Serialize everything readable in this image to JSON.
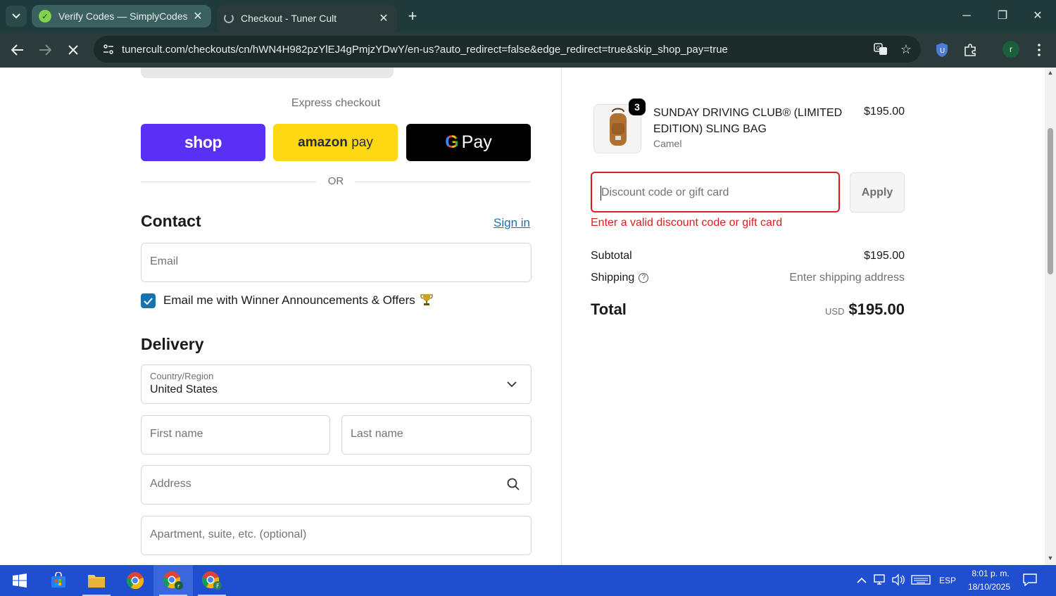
{
  "browser": {
    "tabs": [
      {
        "title": "Verify Codes — SimplyCodes",
        "icon": "simplycodes-favicon",
        "active": false
      },
      {
        "title": "Checkout - Tuner Cult",
        "icon": "loading-icon",
        "active": true
      }
    ],
    "url": "tunercult.com/checkouts/cn/hWN4H982pzYlEJ4gPmjzYDwY/en-us?auto_redirect=false&edge_redirect=true&skip_shop_pay=true",
    "profile_initial": "r"
  },
  "checkout": {
    "express_label": "Express checkout",
    "pay_buttons": {
      "shop": "shop",
      "amazon_word": "amazon",
      "amazon_pay": "pay",
      "gpay_g": "G",
      "gpay_pay": "Pay"
    },
    "or_label": "OR",
    "contact": {
      "title": "Contact",
      "sign_in": "Sign in",
      "email_placeholder": "Email",
      "marketing_label": "Email me with Winner Announcements & Offers",
      "marketing_checked": true
    },
    "delivery": {
      "title": "Delivery",
      "country_label": "Country/Region",
      "country_value": "United States",
      "first_name_placeholder": "First name",
      "last_name_placeholder": "Last name",
      "address_placeholder": "Address",
      "apartment_placeholder": "Apartment, suite, etc. (optional)"
    }
  },
  "summary": {
    "item": {
      "quantity": "3",
      "name": "SUNDAY DRIVING CLUB® (LIMITED EDITION) SLING BAG",
      "variant": "Camel",
      "price": "$195.00"
    },
    "discount_placeholder": "Discount code or gift card",
    "apply_label": "Apply",
    "error": "Enter a valid discount code or gift card",
    "subtotal_label": "Subtotal",
    "subtotal_value": "$195.00",
    "shipping_label": "Shipping",
    "shipping_value": "Enter shipping address",
    "total_label": "Total",
    "total_currency": "USD",
    "total_value": "$195.00"
  },
  "taskbar": {
    "language": "ESP",
    "time": "8:01 p. m.",
    "date": "18/10/2025"
  },
  "colors": {
    "shop_pay": "#5a31f4",
    "amazon_pay": "#ffd814",
    "error": "#dd1d1d",
    "link": "#1773b0"
  }
}
